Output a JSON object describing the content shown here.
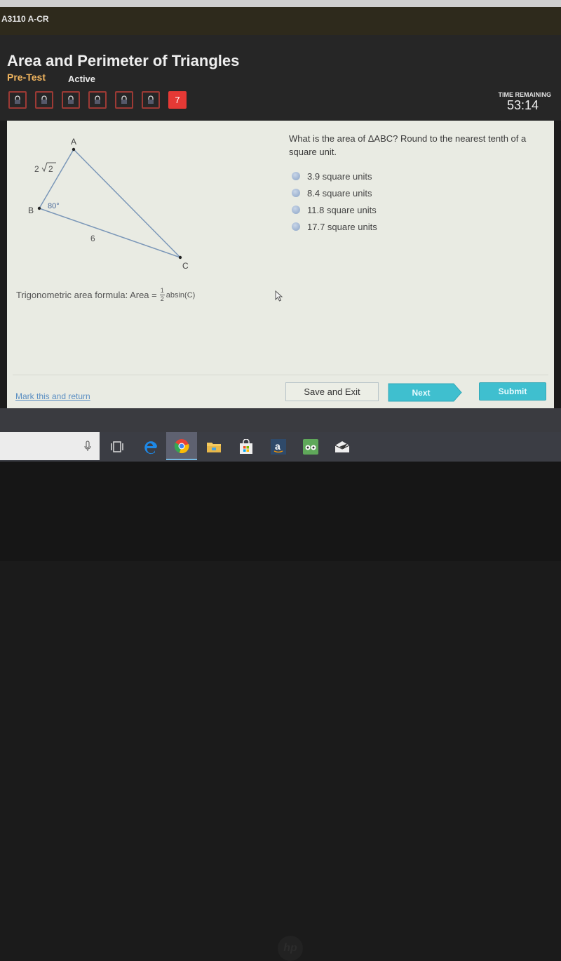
{
  "course": {
    "code": "A3110 A-CR"
  },
  "header": {
    "title": "Area and Perimeter of Triangles",
    "subtitle": "Pre-Test",
    "status": "Active"
  },
  "question_nav": {
    "locked_count": 6,
    "items": [
      {
        "state": "locked",
        "icon": "lock-icon"
      },
      {
        "state": "locked",
        "icon": "lock-icon"
      },
      {
        "state": "locked",
        "icon": "lock-icon"
      },
      {
        "state": "locked",
        "icon": "lock-icon"
      },
      {
        "state": "locked",
        "icon": "lock-icon"
      },
      {
        "state": "locked",
        "icon": "lock-icon"
      },
      {
        "state": "current",
        "label": "7"
      }
    ]
  },
  "timer": {
    "label": "TIME REMAINING",
    "value": "53:14"
  },
  "figure": {
    "vertices": {
      "a": "A",
      "b": "B",
      "c": "C"
    },
    "side_ab": "2√2",
    "side_ab_coefficient": "2",
    "side_ab_radicand": "2",
    "side_bc": "6",
    "angle_b": "80°"
  },
  "question": {
    "text": "What is the area of ΔABC? Round to the nearest tenth of a square unit.",
    "options": [
      {
        "label": "3.9 square units"
      },
      {
        "label": "8.4 square units"
      },
      {
        "label": "11.8 square units"
      },
      {
        "label": "17.7 square units"
      }
    ]
  },
  "formula": {
    "prefix": "Trigonometric area formula: Area =",
    "numerator": "1",
    "denominator": "2",
    "suffix": "absin(C)"
  },
  "footer": {
    "mark_link": "Mark this and return",
    "save_exit": "Save and Exit",
    "next": "Next",
    "submit": "Submit"
  },
  "taskbar": {
    "icons": [
      "microphone-icon",
      "task-view-icon",
      "edge-icon",
      "chrome-icon",
      "file-explorer-icon",
      "store-icon",
      "amazon-icon",
      "tripadvisor-icon",
      "mail-icon"
    ]
  },
  "colors": {
    "accent": "#3fbfcf",
    "current_question": "#e53935",
    "subtitle": "#f0b45e",
    "link": "#5a8ec2"
  }
}
